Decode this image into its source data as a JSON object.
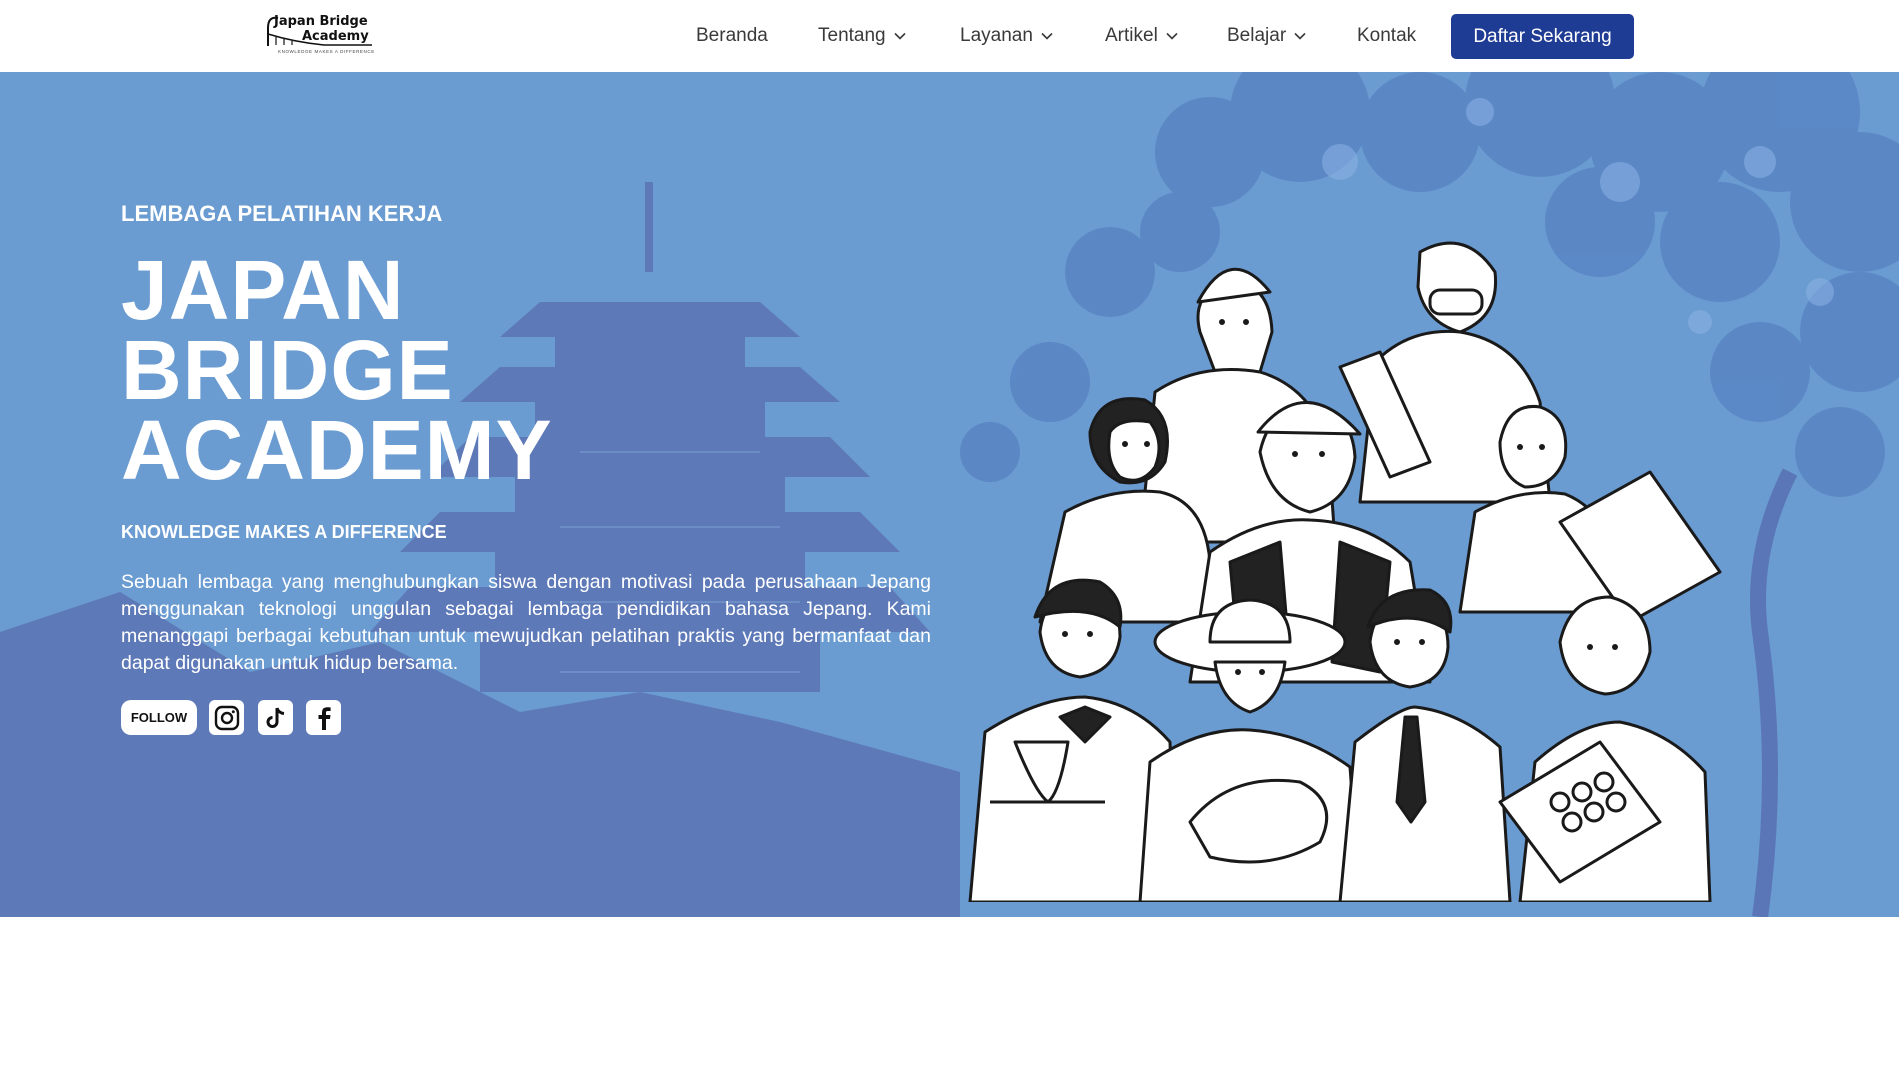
{
  "brand": {
    "name_line1": "Japan Bridge",
    "name_line2": "Academy",
    "tagline": "KNOWLEDGE MAKES A DIFFERENCE"
  },
  "nav": {
    "items": [
      {
        "label": "Beranda",
        "has_dropdown": false
      },
      {
        "label": "Tentang",
        "has_dropdown": true
      },
      {
        "label": "Layanan",
        "has_dropdown": true
      },
      {
        "label": "Artikel",
        "has_dropdown": true
      },
      {
        "label": "Belajar",
        "has_dropdown": true
      },
      {
        "label": "Kontak",
        "has_dropdown": false
      }
    ],
    "cta_label": "Daftar Sekarang"
  },
  "hero": {
    "eyebrow": "LEMBAGA PELATIHAN KERJA",
    "title_lines": [
      "JAPAN",
      "BRIDGE",
      "ACADEMY"
    ],
    "tagline": "KNOWLEDGE MAKES A DIFFERENCE",
    "description": "Sebuah lembaga yang menghubungkan siswa dengan motivasi pada perusahaan Jepang menggunakan teknologi unggulan sebagai lembaga pendidikan bahasa Jepang. Kami menanggapi berbagai kebutuhan untuk mewujudkan pelatihan praktis yang bermanfaat dan dapat digunakan untuk hidup bersama.",
    "follow_label": "FOLLOW",
    "social": [
      {
        "icon": "instagram-icon"
      },
      {
        "icon": "tiktok-icon"
      },
      {
        "icon": "facebook-icon"
      }
    ]
  },
  "colors": {
    "hero_bg": "#6a9bd1",
    "hero_silhouette": "#5b73b0",
    "foliage": "#5a86c4",
    "cta_bg": "#1f3c94",
    "text_on_hero": "#ffffff",
    "nav_text": "#3a3a3a"
  }
}
